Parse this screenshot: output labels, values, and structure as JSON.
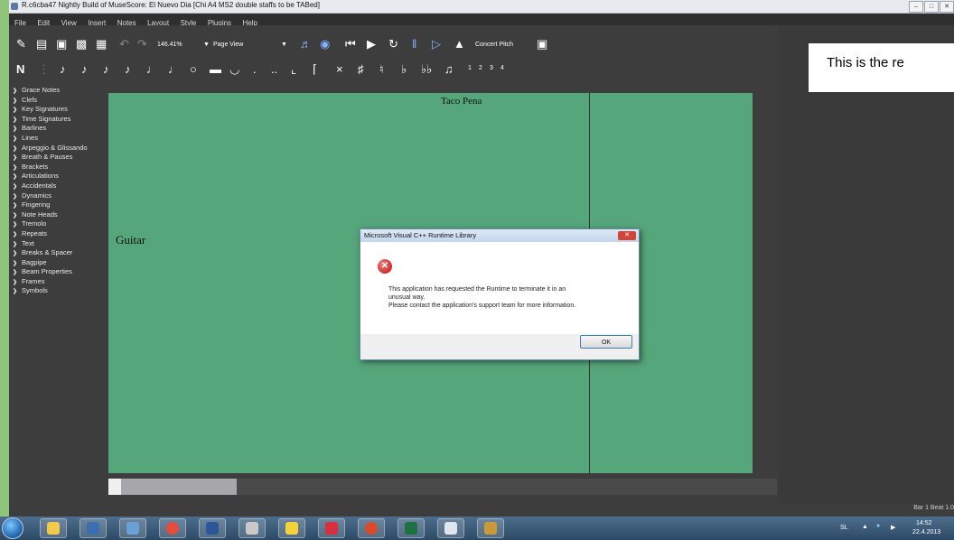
{
  "window": {
    "title": "R.c6cba47 Nightly Build of MuseScore: El Nuevo Dia [Chi A4 MS2 double staffs to be TABed]",
    "controls": [
      "–",
      "□",
      "✕"
    ]
  },
  "menu": [
    "File",
    "Edit",
    "View",
    "Insert",
    "Notes",
    "Layout",
    "Style",
    "Plugins",
    "Help"
  ],
  "toolbar": {
    "zoom": "146.41%",
    "view_mode": "Page View",
    "concert_pitch": "Concert Pitch"
  },
  "note_toolbar": {
    "voices": [
      "1",
      "2",
      "3",
      "4"
    ]
  },
  "palette": [
    "Grace Notes",
    "Clefs",
    "Key Signatures",
    "Time Signatures",
    "Barlines",
    "Lines",
    "Arpeggio & Glissando",
    "Breath & Pauses",
    "Brackets",
    "Articulations",
    "Accidentals",
    "Dynamics",
    "Fingering",
    "Note Heads",
    "Tremolo",
    "Repeats",
    "Text",
    "Breaks & Spacer",
    "Bagpipe",
    "Beam Properties",
    "Frames",
    "Symbols"
  ],
  "score": {
    "composer": "Taco Pena",
    "instrument": "Guitar"
  },
  "callout": "This is the re",
  "status": "Bar  1 Beat  1.0",
  "dialog": {
    "title": "Microsoft Visual C++ Runtime Library",
    "message_lines": [
      "This application has requested the Runtime to terminate it in an",
      "unusual way.",
      "Please contact the application's support team for more information."
    ],
    "ok_label": "OK"
  },
  "tray": {
    "lang": "SL",
    "time": "14:52",
    "date": "22.4.2013"
  },
  "colors": {
    "score_bg": "#55a67a",
    "app_bg": "#3d3d3d",
    "desktop_bg": "#8fc47a"
  }
}
